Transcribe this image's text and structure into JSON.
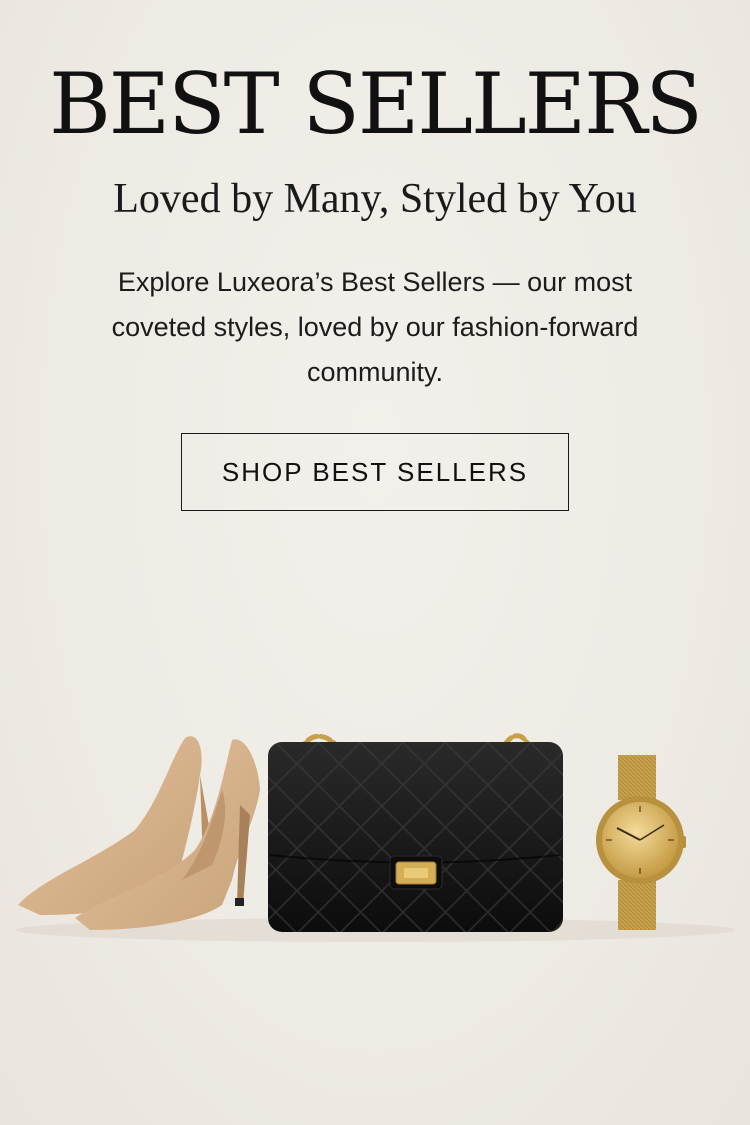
{
  "hero": {
    "title": "BEST SELLERS",
    "subtitle": "Loved by Many, Styled by You",
    "description": "Explore Luxeora’s Best Sellers — our most coveted styles, loved by our fashion-forward community.",
    "cta_label": "SHOP BEST SELLERS"
  },
  "products": [
    {
      "name": "Nude pointed-toe heels",
      "icon": "heels-icon",
      "color": "#d7b48d"
    },
    {
      "name": "Black quilted chain handbag",
      "icon": "handbag-icon",
      "color": "#111111"
    },
    {
      "name": "Gold mesh watch",
      "icon": "watch-icon",
      "color": "#c9a24c"
    }
  ],
  "colors": {
    "background": "#efebe5",
    "text": "#111111",
    "accent_gold": "#c9a24c"
  }
}
